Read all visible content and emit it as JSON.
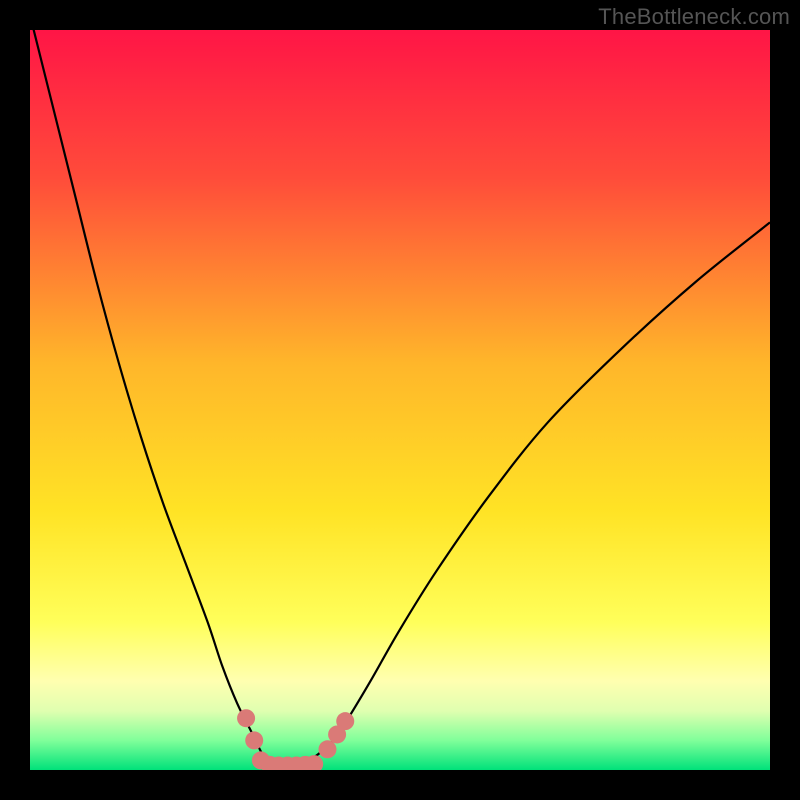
{
  "watermark": "TheBottleneck.com",
  "chart_data": {
    "type": "line",
    "title": "",
    "xlabel": "",
    "ylabel": "",
    "xlim": [
      0,
      100
    ],
    "ylim": [
      0,
      100
    ],
    "background_gradient": {
      "stops": [
        {
          "offset": 0.0,
          "color": "#ff1546"
        },
        {
          "offset": 0.2,
          "color": "#ff4c3a"
        },
        {
          "offset": 0.45,
          "color": "#ffb62a"
        },
        {
          "offset": 0.65,
          "color": "#ffe325"
        },
        {
          "offset": 0.8,
          "color": "#ffff5a"
        },
        {
          "offset": 0.88,
          "color": "#ffffb0"
        },
        {
          "offset": 0.92,
          "color": "#e0ffb0"
        },
        {
          "offset": 0.96,
          "color": "#80ff9a"
        },
        {
          "offset": 1.0,
          "color": "#00e27a"
        }
      ]
    },
    "series": [
      {
        "name": "bottleneck-curve",
        "color": "#000000",
        "width": 2.2,
        "x": [
          0,
          3,
          6,
          9,
          12,
          15,
          18,
          21,
          24,
          26,
          28,
          30,
          31.5,
          33,
          35,
          38,
          41,
          43,
          46,
          50,
          55,
          62,
          70,
          80,
          90,
          100
        ],
        "values": [
          102,
          90,
          78,
          66,
          55,
          45,
          36,
          28,
          20,
          14,
          9,
          5,
          2,
          0.5,
          0.5,
          1.5,
          4,
          7,
          12,
          19,
          27,
          37,
          47,
          57,
          66,
          74
        ]
      }
    ],
    "markers": {
      "name": "highlight-dots",
      "color": "#da7a77",
      "radius": 9,
      "points": [
        {
          "x": 29.2,
          "y": 7.0
        },
        {
          "x": 30.3,
          "y": 4.0
        },
        {
          "x": 31.2,
          "y": 1.3
        },
        {
          "x": 32.4,
          "y": 0.7
        },
        {
          "x": 33.6,
          "y": 0.6
        },
        {
          "x": 34.8,
          "y": 0.6
        },
        {
          "x": 36.0,
          "y": 0.6
        },
        {
          "x": 37.2,
          "y": 0.7
        },
        {
          "x": 38.4,
          "y": 0.8
        },
        {
          "x": 40.2,
          "y": 2.8
        },
        {
          "x": 41.5,
          "y": 4.8
        },
        {
          "x": 42.6,
          "y": 6.6
        }
      ]
    }
  }
}
